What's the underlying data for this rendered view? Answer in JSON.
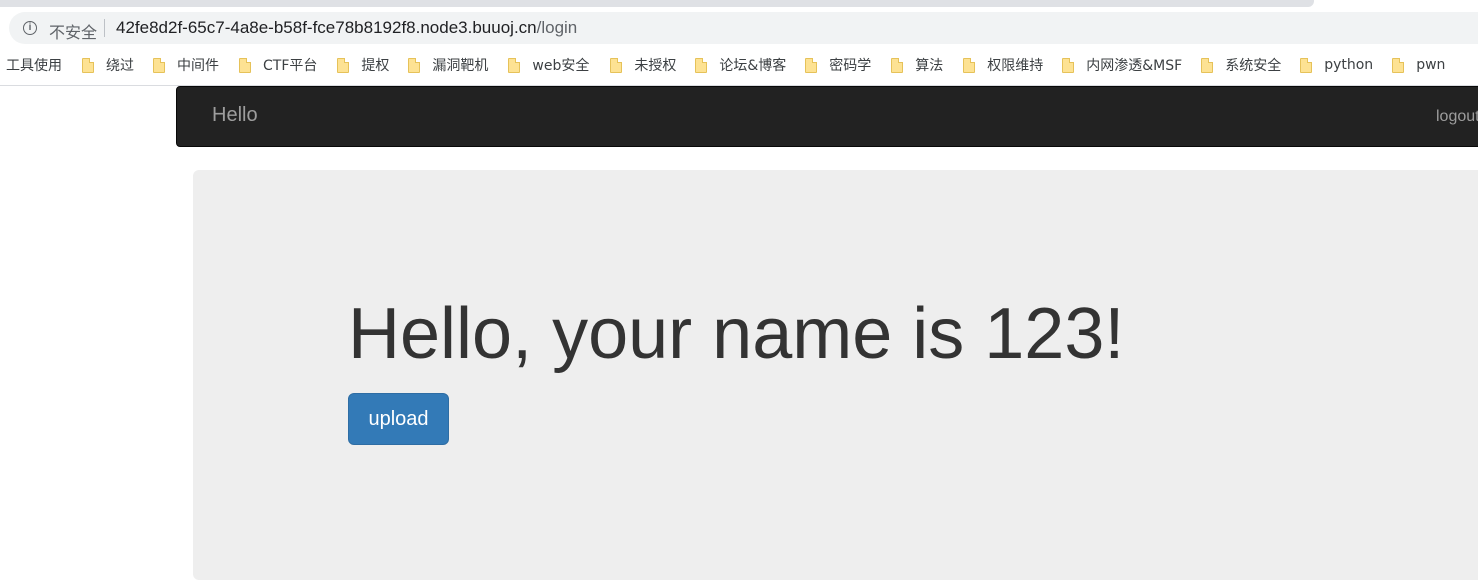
{
  "browser": {
    "security_label": "不安全",
    "url_host": "42fe8d2f-65c7-4a8e-b58f-fce78b8192f8.node3.buuoj.cn",
    "url_path": "/login",
    "bookmarks": [
      {
        "label": "工具使用",
        "icon": null
      },
      {
        "label": "绕过",
        "icon": "folder-icon"
      },
      {
        "label": "中间件",
        "icon": "folder-icon"
      },
      {
        "label": "CTF平台",
        "icon": "folder-icon"
      },
      {
        "label": "提权",
        "icon": "folder-icon"
      },
      {
        "label": "漏洞靶机",
        "icon": "folder-icon"
      },
      {
        "label": "web安全",
        "icon": "folder-icon"
      },
      {
        "label": "未授权",
        "icon": "folder-icon"
      },
      {
        "label": "论坛&博客",
        "icon": "folder-icon"
      },
      {
        "label": "密码学",
        "icon": "folder-icon"
      },
      {
        "label": "算法",
        "icon": "folder-icon"
      },
      {
        "label": "权限维持",
        "icon": "folder-icon"
      },
      {
        "label": "内网渗透&MSF",
        "icon": "folder-icon"
      },
      {
        "label": "系统安全",
        "icon": "folder-icon"
      },
      {
        "label": "python",
        "icon": "folder-icon"
      },
      {
        "label": "pwn",
        "icon": "folder-icon"
      }
    ]
  },
  "navbar": {
    "brand": "Hello",
    "logout_label": "logout"
  },
  "main": {
    "greeting": "Hello, your name is 123!",
    "upload_label": "upload"
  },
  "colors": {
    "navbar_bg": "#222222",
    "jumbotron_bg": "#eeeeee",
    "button_primary": "#337ab7"
  }
}
